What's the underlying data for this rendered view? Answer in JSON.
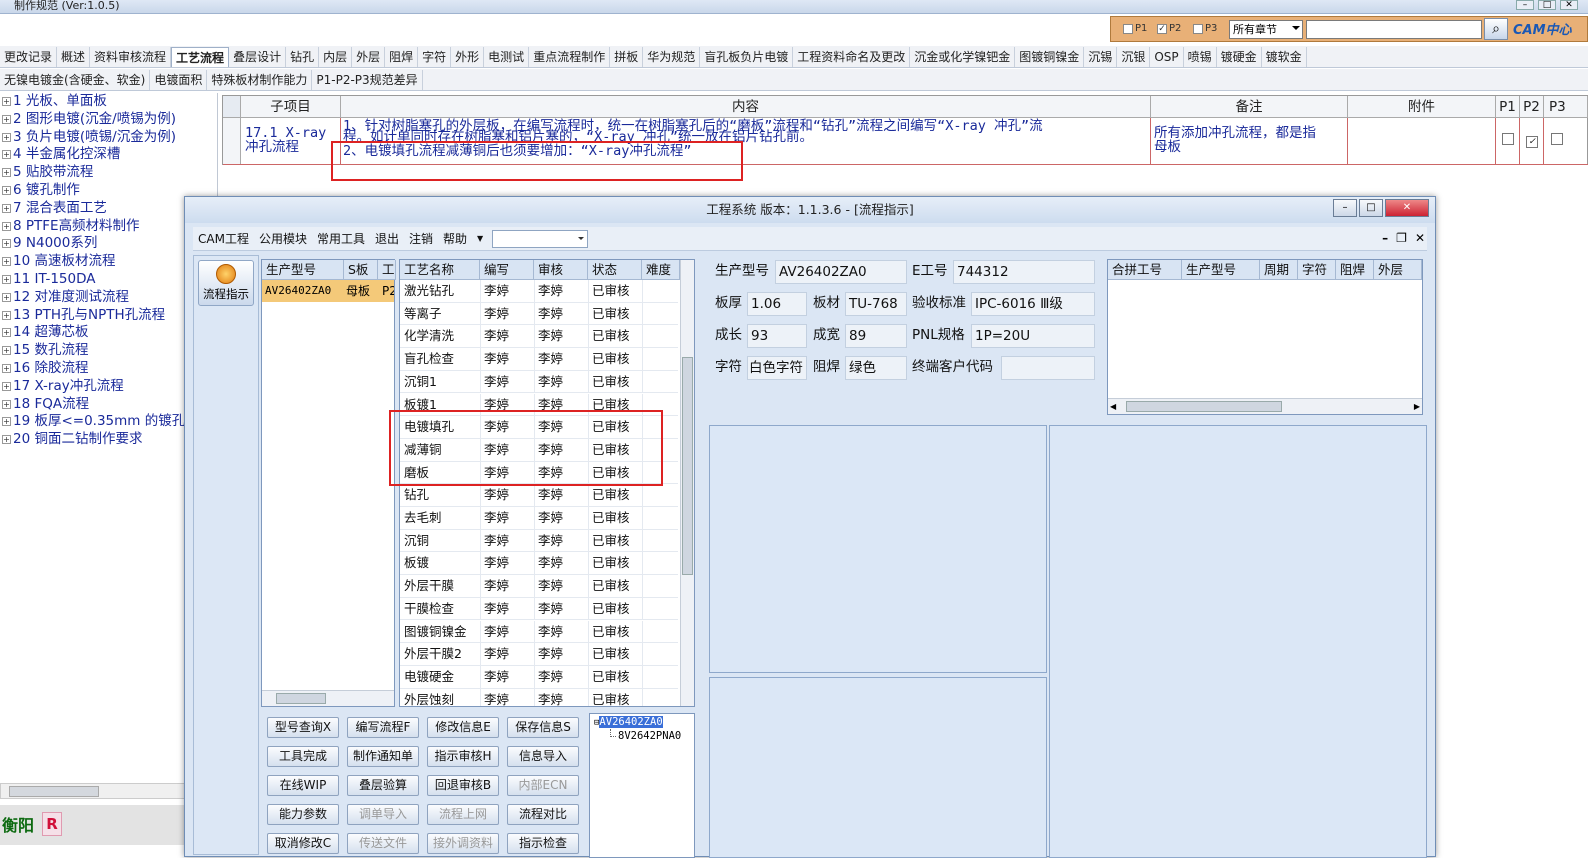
{
  "app_title": "制作规范 (Ver:1.0.5)",
  "filter": {
    "p1": "P1",
    "p2": "P2",
    "p3": "P3",
    "p1_checked": false,
    "p2_checked": true,
    "p3_checked": false,
    "chapter": "所有章节",
    "search_value": "",
    "logo": "CAM中心"
  },
  "tabs_row1": [
    "更改记录",
    "概述",
    "资料审核流程",
    "工艺流程",
    "叠层设计",
    "钻孔",
    "内层",
    "外层",
    "阻焊",
    "字符",
    "外形",
    "电测试",
    "重点流程制作",
    "拼板",
    "华为规范",
    "盲孔板负片电镀",
    "工程资料命名及更改",
    "沉金或化学镍钯金",
    "图镀铜镍金",
    "沉锡",
    "沉银",
    "OSP",
    "喷锡",
    "镀硬金",
    "镀软金"
  ],
  "active_tab": "工艺流程",
  "tabs_row2": [
    "无镍电镀金(含硬金、软金)",
    "电镀面积",
    "特殊板材制作能力",
    "P1-P2-P3规范差异"
  ],
  "tree": [
    "1 光板、单面板",
    "2 图形电镀(沉金/喷锡为例)",
    "3 负片电镀(喷锡/沉金为例)",
    "4 半金属化控深槽",
    "5 贴胶带流程",
    "6 镀孔制作",
    "7 混合表面工艺",
    "8 PTFE高频材料制作",
    "9 N4000系列",
    "10 高速板材流程",
    "11 IT-150DA",
    "12 对准度测试流程",
    "13 PTH孔与NPTH孔流程",
    "14 超薄芯板",
    "15 数孔流程",
    "16 除胶流程",
    "17 X-ray冲孔流程",
    "18 FQA流程",
    "19 板厚<=0.35mm 的镀孔",
    "20 铜面二钻制作要求"
  ],
  "status": {
    "city": "衡阳",
    "badge": "R"
  },
  "grid": {
    "headers": {
      "sub": "子项目",
      "content": "内容",
      "remark": "备注",
      "attach": "附件",
      "p1": "P1",
      "p2": "P2",
      "p3": "P3"
    },
    "row": {
      "sub_line1": "17.1 X-ray",
      "sub_line2": "冲孔流程",
      "content_line1": "1、针对树脂塞孔的外层板，在编写流程时，统一在树脂塞孔后的“磨板”流程和“钻孔”流程之间编写“X-ray 冲孔”流",
      "content_line2": "程。如计单同时存在树脂塞和铝片塞的，“X-ray 冲孔”统一放在铝片钻孔前。",
      "content_line3": "2、电镀填孔流程减薄铜后也须要增加：“X-ray冲孔流程”",
      "remark_line1": "所有添加冲孔流程，都是指",
      "remark_line2": "母板",
      "attach": "",
      "p1_checked": false,
      "p2_checked": true,
      "p3_checked": false
    }
  },
  "window": {
    "title": "工程系统   版本：1.1.3.6 - [流程指示]",
    "menus": [
      "CAM工程",
      "公用模块",
      "常用工具",
      "退出",
      "注销",
      "帮助"
    ],
    "flow_button": "流程指示",
    "model_table": {
      "headers": [
        "生产型号",
        "S板",
        "工"
      ],
      "rows": [
        [
          "AV26402ZA0",
          "母板",
          "P2"
        ]
      ]
    },
    "process_table": {
      "headers": [
        "工艺名称",
        "编写",
        "审核",
        "状态",
        "难度"
      ],
      "rows": [
        [
          "激光钻孔",
          "李婷",
          "李婷",
          "已审核",
          ""
        ],
        [
          "等离子",
          "李婷",
          "李婷",
          "已审核",
          ""
        ],
        [
          "化学清洗",
          "李婷",
          "李婷",
          "已审核",
          ""
        ],
        [
          "盲孔检查",
          "李婷",
          "李婷",
          "已审核",
          ""
        ],
        [
          "沉铜1",
          "李婷",
          "李婷",
          "已审核",
          ""
        ],
        [
          "板镀1",
          "李婷",
          "李婷",
          "已审核",
          ""
        ],
        [
          "电镀填孔",
          "李婷",
          "李婷",
          "已审核",
          ""
        ],
        [
          "减薄铜",
          "李婷",
          "李婷",
          "已审核",
          ""
        ],
        [
          "磨板",
          "李婷",
          "李婷",
          "已审核",
          ""
        ],
        [
          "钻孔",
          "李婷",
          "李婷",
          "已审核",
          ""
        ],
        [
          "去毛刺",
          "李婷",
          "李婷",
          "已审核",
          ""
        ],
        [
          "沉铜",
          "李婷",
          "李婷",
          "已审核",
          ""
        ],
        [
          "板镀",
          "李婷",
          "李婷",
          "已审核",
          ""
        ],
        [
          "外层干膜",
          "李婷",
          "李婷",
          "已审核",
          ""
        ],
        [
          "干膜检查",
          "李婷",
          "李婷",
          "已审核",
          ""
        ],
        [
          "图镀铜镍金",
          "李婷",
          "李婷",
          "已审核",
          ""
        ],
        [
          "外层干膜2",
          "李婷",
          "李婷",
          "已审核",
          ""
        ],
        [
          "电镀硬金",
          "李婷",
          "李婷",
          "已审核",
          ""
        ],
        [
          "外层蚀刻",
          "李婷",
          "李婷",
          "已审核",
          ""
        ]
      ]
    },
    "info": {
      "model_label": "生产型号",
      "model": "AV26402ZA0",
      "e_label": "E工号",
      "e_no": "744312",
      "thick_label": "板厚",
      "thick": "1.06",
      "mat_label": "板材",
      "mat": "TU-768",
      "std_label": "验收标准",
      "std": "IPC-6016 Ⅲ级",
      "len_label": "成长",
      "len": "93",
      "wid_label": "成宽",
      "wid": "89",
      "pnl_label": "PNL规格",
      "pnl": "1P=20U",
      "char_label": "字符",
      "char": "白色字符",
      "mask_label": "阻焊",
      "mask": "绿色",
      "cust_label": "终端客户代码",
      "cust": ""
    },
    "combine_table": {
      "headers": [
        "合拼工号",
        "生产型号",
        "周期",
        "字符",
        "阻焊",
        "外层"
      ]
    },
    "buttons": [
      [
        "型号查询X",
        "编写流程F",
        "修改信息E",
        "保存信息S"
      ],
      [
        "工具完成",
        "制作通知单",
        "指示审核H",
        "信息导入"
      ],
      [
        "在线WIP",
        "叠层验算",
        "回退审核B",
        "内部ECN"
      ],
      [
        "能力参数",
        "调单导入",
        "流程上网",
        "流程对比"
      ],
      [
        "取消修改C",
        "传送文件",
        "接外调资料",
        "指示检查"
      ]
    ],
    "disabled_buttons": [
      "内部ECN",
      "调单导入",
      "流程上网",
      "传送文件",
      "接外调资料"
    ],
    "model_tree": {
      "root": "AV26402ZA0",
      "child": "8V2642PNA0"
    }
  }
}
